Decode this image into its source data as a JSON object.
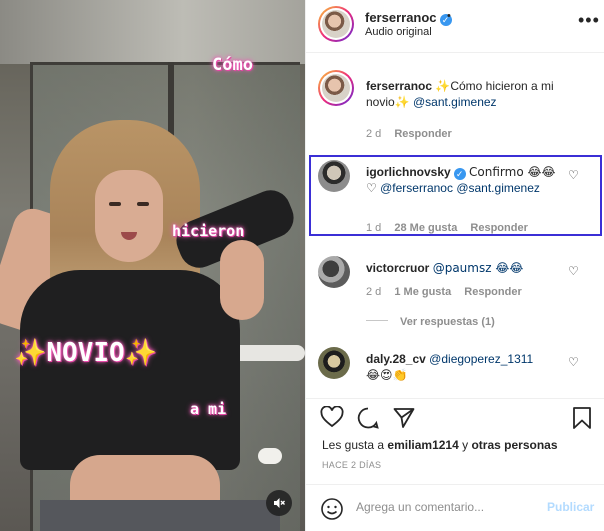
{
  "video": {
    "overlay": {
      "como": "Cómo",
      "hicieron": "hicieron",
      "novio": "✨NOVIO✨",
      "ami": "a mi"
    },
    "mute_icon": "speaker-muted-icon"
  },
  "header": {
    "username": "ferserranoc",
    "dot": "•",
    "subtitle": "Audio original",
    "more_icon": "more-horizontal-icon"
  },
  "caption": {
    "username": "ferserranoc",
    "text": "✨Cómo hicieron a mi novio✨",
    "mention": "@sant.gimenez",
    "time": "2 d",
    "reply": "Responder"
  },
  "comments": [
    {
      "username": "igorlichnovsky",
      "text": "Confirmo 😂😂♡",
      "mentions": "@ferserranoc @sant.gimenez",
      "time": "1 d",
      "likes": "28 Me gusta",
      "reply": "Responder"
    },
    {
      "username": "victorcruor",
      "text": "@paumsz 😂😂",
      "time": "2 d",
      "likes": "1 Me gusta",
      "reply": "Responder",
      "view_replies": "Ver respuestas (1)"
    },
    {
      "username": "daly.28_cv",
      "text_mention": "@diegoperez_1311",
      "emojis": "😂😍👏",
      "time": "",
      "reply": ""
    }
  ],
  "actions": {
    "like_icon": "heart-icon",
    "comment_icon": "comment-icon",
    "share_icon": "paper-plane-icon",
    "save_icon": "bookmark-icon"
  },
  "likes_prefix": "Les gusta a",
  "likes_user": "emiliam1214",
  "likes_connector": "y",
  "likes_others": "otras personas",
  "date": "HACE 2 DÍAS",
  "add_comment": {
    "placeholder": "Agrega un comentario...",
    "publish": "Publicar",
    "emoji_icon": "smiley-icon"
  },
  "colors": {
    "highlight_border": "#3b2fd6",
    "verified": "#3897f0",
    "mention": "#00376b",
    "publish_disabled": "#b3dbff"
  }
}
